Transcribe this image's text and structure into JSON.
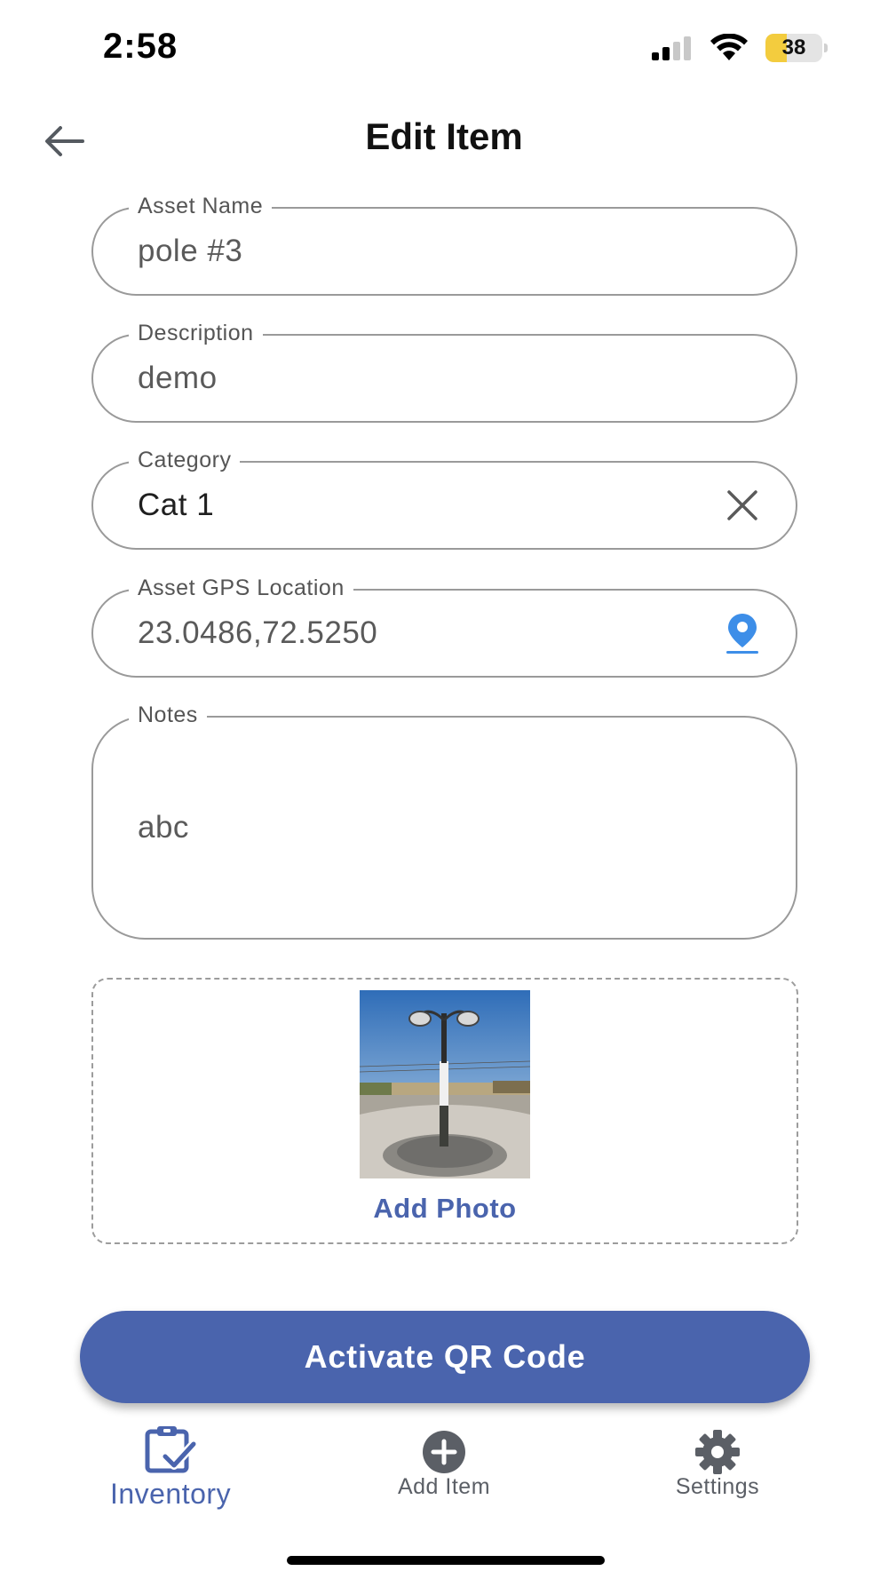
{
  "status_bar": {
    "time": "2:58",
    "battery_percent": "38",
    "battery_level": 0.38,
    "signal_bars_active": 2,
    "signal_bars_total": 4
  },
  "header": {
    "title": "Edit Item",
    "back_icon": "arrow-left-icon"
  },
  "form": {
    "asset_name": {
      "label": "Asset Name",
      "value": "pole #3"
    },
    "description": {
      "label": "Description",
      "value": "demo"
    },
    "category": {
      "label": "Category",
      "value": "Cat 1",
      "clear_icon": "close-icon"
    },
    "gps": {
      "label": "Asset GPS Location",
      "value": "23.0486,72.5250",
      "icon": "location-pin-icon"
    },
    "notes": {
      "label": "Notes",
      "value": "abc"
    }
  },
  "photo": {
    "add_label": "Add Photo"
  },
  "cta": {
    "label": "Activate QR Code"
  },
  "bottom_nav": {
    "items": [
      {
        "label": "Inventory",
        "icon": "clipboard-check-icon",
        "active": true
      },
      {
        "label": "Add Item",
        "icon": "plus-circle-icon",
        "active": false
      },
      {
        "label": "Settings",
        "icon": "gear-icon",
        "active": false
      }
    ]
  },
  "colors": {
    "accent": "#4a64ad",
    "pin": "#3d8ee8",
    "battery": "#f3cc3e"
  }
}
